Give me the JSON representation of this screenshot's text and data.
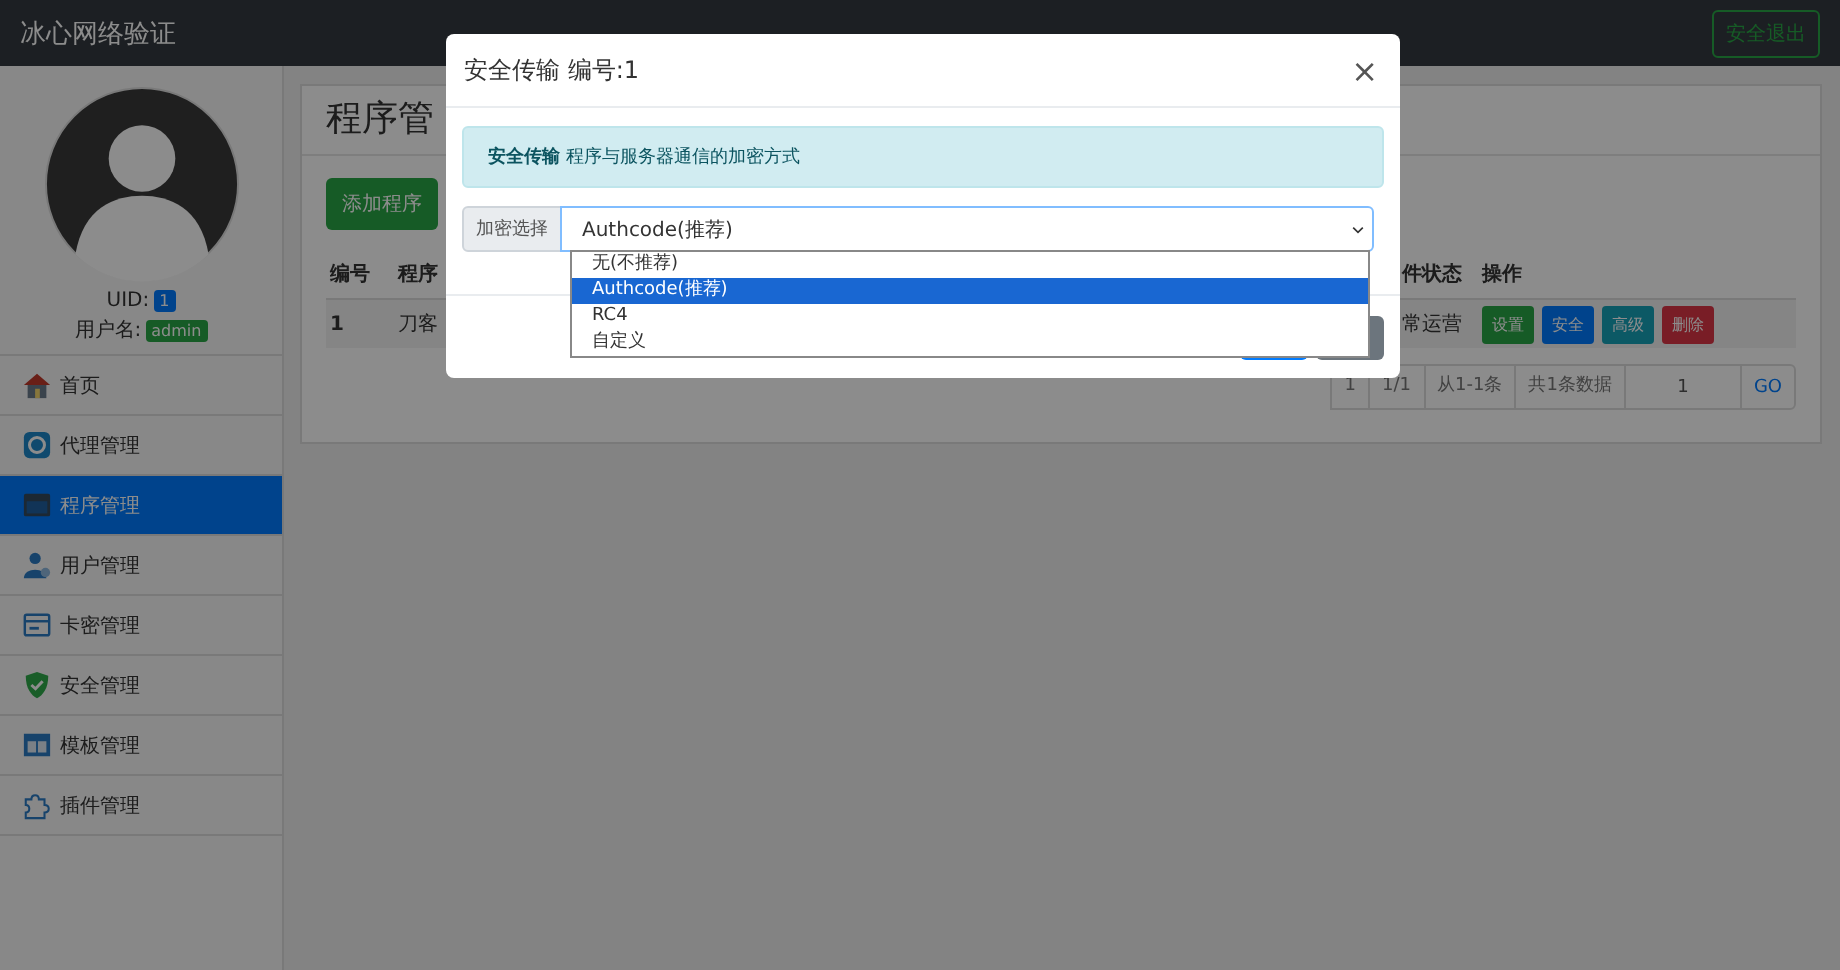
{
  "navbar": {
    "brand": "冰心网络验证",
    "logout_button": "安全退出"
  },
  "profile": {
    "uid_label": "UID:",
    "uid": "1",
    "username_label": "用户名:",
    "username": "admin"
  },
  "sidebar": {
    "items": [
      {
        "label": "首页",
        "kind": "home",
        "selected": false
      },
      {
        "label": "代理管理",
        "kind": "agent",
        "selected": false
      },
      {
        "label": "程序管理",
        "kind": "program",
        "selected": true
      },
      {
        "label": "用户管理",
        "kind": "user",
        "selected": false
      },
      {
        "label": "卡密管理",
        "kind": "card",
        "selected": false
      },
      {
        "label": "安全管理",
        "kind": "shield",
        "selected": false
      },
      {
        "label": "模板管理",
        "kind": "template",
        "selected": false
      },
      {
        "label": "插件管理",
        "kind": "plugin",
        "selected": false
      }
    ]
  },
  "main": {
    "title": "程序管",
    "add_button": "添加程序",
    "table": {
      "columns": [
        "编号",
        "程序",
        "件状态",
        "操作"
      ],
      "rows": [
        {
          "cells": [
            "1",
            "刀客",
            "常运营"
          ],
          "actions": [
            {
              "label": "设置",
              "kind": "success"
            },
            {
              "label": "安全",
              "kind": "primary"
            },
            {
              "label": "高级",
              "kind": "info"
            },
            {
              "label": "删除",
              "kind": "danger"
            }
          ]
        }
      ]
    },
    "pagination": {
      "items": [
        "1",
        "1/1",
        "从1-1条",
        "共1条数据"
      ],
      "page_input": "1",
      "go": "GO"
    }
  },
  "modal": {
    "title": "安全传输 编号:1",
    "close": "×",
    "alert": "**安全传输** 程序与服务器通信的加密方式",
    "input_label": "加密选择",
    "select_value": "Authcode(推荐)",
    "options": [
      {
        "label": "无(不推荐)",
        "selected": false
      },
      {
        "label": "Authcode(推荐)",
        "selected": true
      },
      {
        "label": "RC4",
        "selected": false
      },
      {
        "label": "自定义",
        "selected": false
      }
    ]
  }
}
